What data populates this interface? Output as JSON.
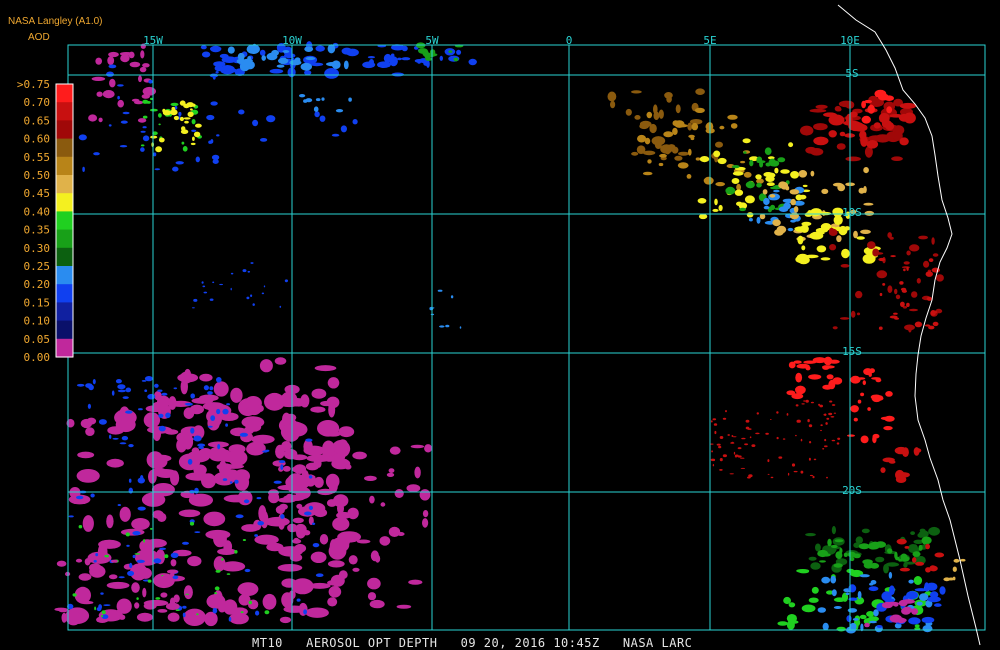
{
  "header": {
    "title": "NASA Langley (A1.0)",
    "parameter": "AOD"
  },
  "footer": {
    "product": "MT10",
    "field": "AEROSOL OPT DEPTH",
    "date": "09 20, 2016",
    "time": "10:45Z",
    "source": "NASA LARC"
  },
  "map": {
    "lon_labels": [
      "15W",
      "10W",
      "5W",
      "0",
      "5E",
      "10E"
    ],
    "lat_labels": [
      "5S",
      "10S",
      "15S",
      "20S"
    ],
    "grid_color": "#2ad3d3",
    "coast_color": "#ffffff"
  },
  "legend": {
    "labels": [
      ">0.75",
      "0.70",
      "0.65",
      "0.60",
      "0.55",
      "0.50",
      "0.45",
      "0.40",
      "0.35",
      "0.30",
      "0.25",
      "0.20",
      "0.15",
      "0.10",
      "0.05",
      "0.00"
    ],
    "colors": [
      "#ff1c1c",
      "#c81010",
      "#a00808",
      "#8a5a0e",
      "#b88418",
      "#e0b24a",
      "#f4f020",
      "#20d020",
      "#18a018",
      "#0c6010",
      "#2a8cf0",
      "#1040f0",
      "#1020a0",
      "#0a106a",
      "#c0289c"
    ]
  },
  "colors": {
    "magenta": "#c0289c",
    "navy": "#0a106a",
    "dblue": "#1020a0",
    "blue": "#1040f0",
    "lblue": "#2a8cf0",
    "dgreen": "#0c6010",
    "green": "#18a018",
    "lgreen": "#20d020",
    "yellow": "#f4f020",
    "tan": "#e0b24a",
    "gold": "#b88418",
    "brown": "#8a5a0e",
    "dred": "#a00808",
    "red": "#c81010",
    "bred": "#ff1c1c"
  }
}
